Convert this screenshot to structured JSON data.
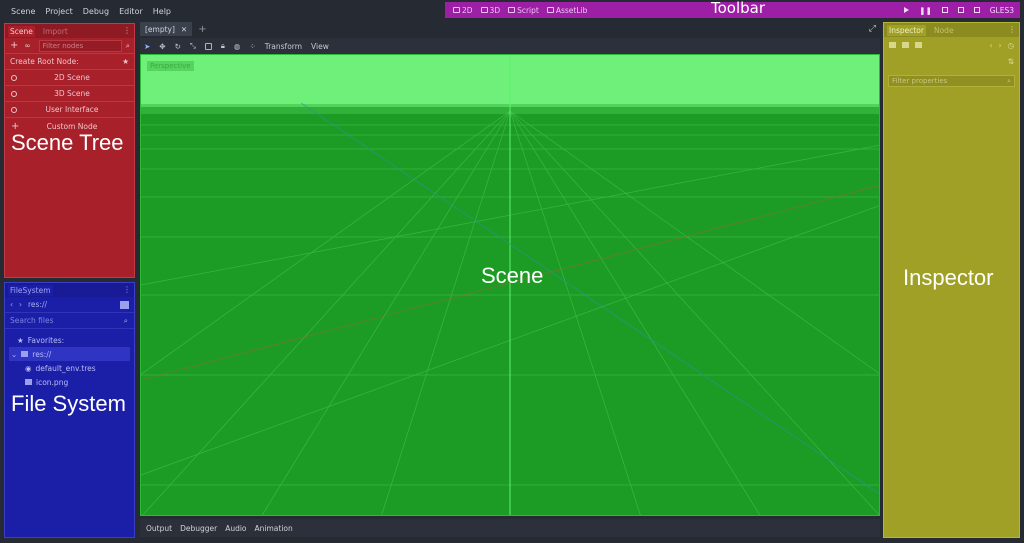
{
  "menu": [
    "Scene",
    "Project",
    "Debug",
    "Editor",
    "Help"
  ],
  "toolbar": {
    "label": "Toolbar",
    "modes": [
      "2D",
      "3D",
      "Script",
      "AssetLib"
    ],
    "renderer": "GLES3"
  },
  "scene_dock": {
    "tabs": [
      "Scene",
      "Import"
    ],
    "filter_placeholder": "Filter nodes",
    "create_root_label": "Create Root Node:",
    "items": [
      "2D Scene",
      "3D Scene",
      "User Interface",
      "Custom Node"
    ],
    "overlay_label": "Scene Tree"
  },
  "filesystem": {
    "tab": "FileSystem",
    "path": "res://",
    "search_placeholder": "Search files",
    "favorites_label": "Favorites:",
    "root": "res://",
    "files": [
      "default_env.tres",
      "icon.png"
    ],
    "overlay_label": "File System"
  },
  "editor_tabs": [
    "[empty]"
  ],
  "viewport_toolbar": {
    "transform": "Transform",
    "view": "View"
  },
  "viewport": {
    "perspective": "Perspective",
    "overlay_label": "Scene"
  },
  "bottom_panel": [
    "Output",
    "Debugger",
    "Audio",
    "Animation"
  ],
  "inspector": {
    "tabs": [
      "Inspector",
      "Node"
    ],
    "filter_placeholder": "Filter properties",
    "overlay_label": "Inspector"
  },
  "colors": {
    "toolbar": "#9c1fa6",
    "scene_tree": "#a7202a",
    "file_system": "#1b1fa8",
    "scene": "#1d9c25",
    "inspector": "#a0a027"
  }
}
